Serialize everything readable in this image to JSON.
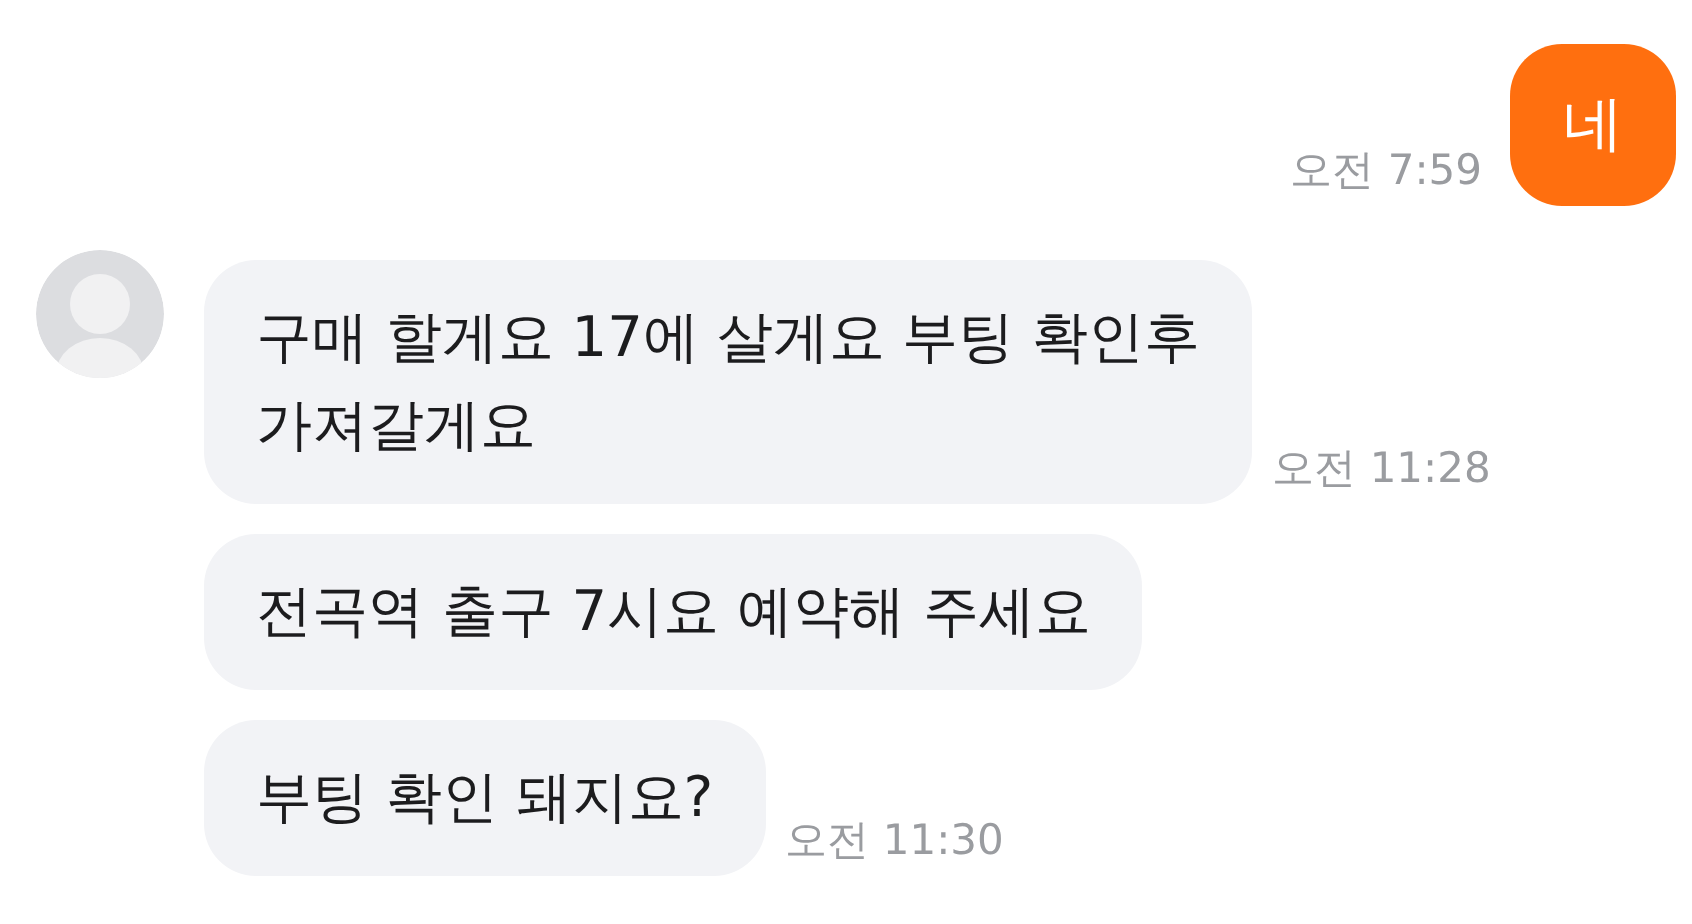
{
  "messages": [
    {
      "kind": "outgoing",
      "text": "네",
      "time": "오전 7:59"
    },
    {
      "kind": "incoming",
      "avatar": true,
      "text": "구매 할게요 17에 살게요 부팅 확인후\n가져갈게요",
      "time": "오전 11:28"
    },
    {
      "kind": "incoming",
      "text": "전곡역 출구 7시요 예약해 주세요"
    },
    {
      "kind": "incoming",
      "text": "부팅 확인 돼지요?",
      "time": "오전 11:30"
    }
  ]
}
